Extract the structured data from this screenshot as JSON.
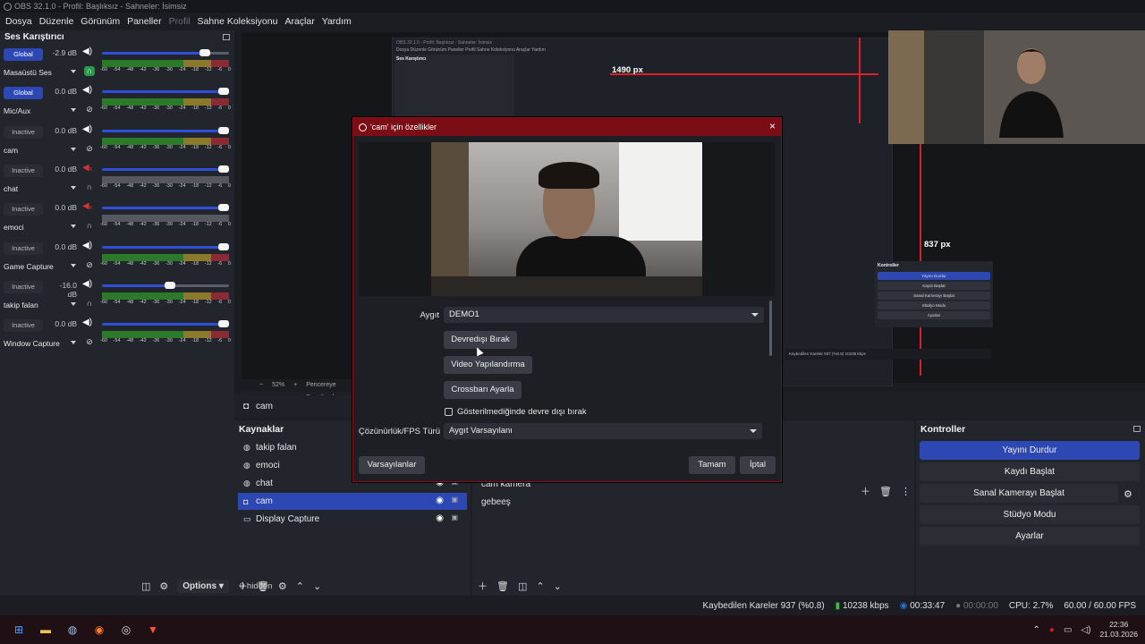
{
  "window": {
    "title": "OBS 32.1.0 - Profil: Başlıksız - Sahneler: İsimsiz"
  },
  "menu": [
    "Dosya",
    "Düzenle",
    "Görünüm",
    "Paneller",
    "Profil",
    "Sahne Koleksiyonu",
    "Araçlar",
    "Yardım"
  ],
  "mixer": {
    "title": "Ses Karıştırıcı",
    "ticks": [
      "-60",
      "-54",
      "-48",
      "-42",
      "-36",
      "-30",
      "-24",
      "-18",
      "-12",
      "-6",
      "0"
    ],
    "channels": [
      {
        "badge": "Global",
        "badge_type": "global",
        "db": "-2.9 dB",
        "name": "Masaüstü Ses",
        "volume": 0.84,
        "muted": false,
        "meter_on": true,
        "hp_on": true,
        "icon": "headphones-icon"
      },
      {
        "badge": "Global",
        "badge_type": "global",
        "db": "0.0 dB",
        "name": "Mic/Aux",
        "volume": 1.0,
        "muted": false,
        "meter_on": true,
        "hp_on": false,
        "icon": "monitor-off-icon"
      },
      {
        "badge": "Inactive",
        "badge_type": "inactive",
        "db": "0.0 dB",
        "name": "cam",
        "volume": 1.0,
        "muted": false,
        "meter_on": true,
        "hp_on": false,
        "icon": "monitor-off-icon"
      },
      {
        "badge": "Inactive",
        "badge_type": "inactive",
        "db": "0.0 dB",
        "name": "chat",
        "volume": 1.0,
        "muted": true,
        "meter_on": false,
        "hp_on": false,
        "icon": "headphones-icon"
      },
      {
        "badge": "Inactive",
        "badge_type": "inactive",
        "db": "0.0 dB",
        "name": "emoci",
        "volume": 1.0,
        "muted": true,
        "meter_on": false,
        "hp_on": false,
        "icon": "headphones-icon"
      },
      {
        "badge": "Inactive",
        "badge_type": "inactive",
        "db": "0.0 dB",
        "name": "Game Capture",
        "volume": 1.0,
        "muted": false,
        "meter_on": true,
        "hp_on": false,
        "icon": "monitor-off-icon"
      },
      {
        "badge": "Inactive",
        "badge_type": "inactive",
        "db": "-16.0 dB",
        "name": "takip falan",
        "volume": 0.54,
        "muted": false,
        "meter_on": true,
        "hp_on": false,
        "icon": "headphones-icon"
      },
      {
        "badge": "Inactive",
        "badge_type": "inactive",
        "db": "0.0 dB",
        "name": "Window Capture",
        "volume": 1.0,
        "muted": false,
        "meter_on": true,
        "hp_on": false,
        "icon": "monitor-off-icon"
      }
    ]
  },
  "preview": {
    "zoom": "52%",
    "fit_label": "Pencereye Boyutlandır",
    "width_label_1": "1490 px",
    "width_label_2": "837 px",
    "nested_menu": "Dosya  Düzenle  Görünüm  Paneller  Profil  Sahne Koleksiyonu  Araçlar  Yardım",
    "nested_mixer_title": "Ses Karıştırıcı",
    "nested_controls": {
      "title": "Kontroller",
      "buttons": [
        "Yayını Durdur",
        "Kaydı Başlat",
        "Sanal Kamerayı Başlat",
        "Stüdyo Modu",
        "Ayarlar"
      ]
    }
  },
  "scene_label": "cam",
  "sources": {
    "title": "Kaynaklar",
    "items": [
      {
        "name": "takip falan",
        "icon": "globe-icon",
        "selected": false
      },
      {
        "name": "emoci",
        "icon": "globe-icon",
        "selected": false
      },
      {
        "name": "chat",
        "icon": "globe-icon",
        "selected": false
      },
      {
        "name": "cam",
        "icon": "camera-icon",
        "selected": true
      },
      {
        "name": "Display Capture",
        "icon": "monitor-icon",
        "selected": false
      }
    ],
    "hidden_count": "0 hidden",
    "options_label": "Options"
  },
  "transitions": {
    "items": [
      "cam kamera",
      "gebeeş"
    ]
  },
  "controls": {
    "title": "Kontroller",
    "buttons": [
      {
        "label": "Yayını Durdur",
        "primary": true
      },
      {
        "label": "Kaydı Başlat",
        "primary": false
      },
      {
        "label": "Sanal Kamerayı Başlat",
        "primary": false
      },
      {
        "label": "Stüdyo Modu",
        "primary": false
      },
      {
        "label": "Ayarlar",
        "primary": false
      }
    ]
  },
  "status": {
    "dropped": "Kaybedilen Kareler 937 (%0.8)",
    "bitrate": "10238 kbps",
    "stream_time": "00:33:47",
    "rec_time": "00:00:00",
    "cpu": "CPU: 2.7%",
    "fps": "60.00 / 60.00 FPS"
  },
  "taskbar": {
    "time": "22:36",
    "date": "21.03.2026"
  },
  "dialog": {
    "title": "'cam' için özellikler",
    "device_label": "Aygıt",
    "device_value": "DEMO1",
    "btn_deactivate": "Devredışı Bırak",
    "btn_video_config": "Video Yapılandırma",
    "btn_crossbar": "Crossbarı Ayarla",
    "checkbox_label": "Gösterilmediğinde devre dışı bırak",
    "resolution_label": "Çözünürlük/FPS Türü",
    "resolution_value": "Aygıt Varsayılanı",
    "btn_defaults": "Varsayılanlar",
    "btn_ok": "Tamam",
    "btn_cancel": "İptal"
  },
  "colors": {
    "accent": "#2d48b3",
    "red": "#e01e2a",
    "green_meter": "#2a7a2a"
  }
}
